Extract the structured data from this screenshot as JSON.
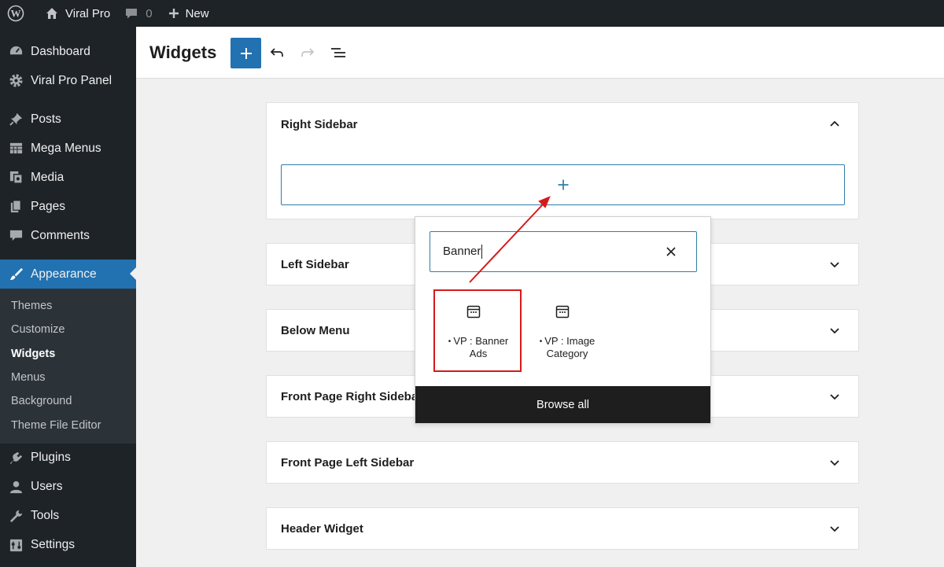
{
  "adminbar": {
    "site_name": "Viral Pro",
    "comments_count": "0",
    "new_label": "New"
  },
  "sidebar": {
    "items": [
      {
        "label": "Dashboard",
        "icon": "dashboard-icon"
      },
      {
        "label": "Viral Pro Panel",
        "icon": "gear-icon"
      },
      {
        "label": "Posts",
        "icon": "pin-icon"
      },
      {
        "label": "Mega Menus",
        "icon": "table-icon"
      },
      {
        "label": "Media",
        "icon": "media-icon"
      },
      {
        "label": "Pages",
        "icon": "pages-icon"
      },
      {
        "label": "Comments",
        "icon": "comment-icon"
      },
      {
        "label": "Appearance",
        "icon": "brush-icon"
      },
      {
        "label": "Plugins",
        "icon": "plugin-icon"
      },
      {
        "label": "Users",
        "icon": "user-icon"
      },
      {
        "label": "Tools",
        "icon": "wrench-icon"
      },
      {
        "label": "Settings",
        "icon": "settings-icon"
      }
    ],
    "submenu": [
      "Themes",
      "Customize",
      "Widgets",
      "Menus",
      "Background",
      "Theme File Editor"
    ],
    "active_submenu": "Widgets"
  },
  "header": {
    "title": "Widgets"
  },
  "widget_areas": [
    {
      "title": "Right Sidebar",
      "expanded": true
    },
    {
      "title": "Left Sidebar",
      "expanded": false
    },
    {
      "title": "Below Menu",
      "expanded": false
    },
    {
      "title": "Front Page Right Sidebar",
      "expanded": false
    },
    {
      "title": "Front Page Left Sidebar",
      "expanded": false
    },
    {
      "title": "Header Widget",
      "expanded": false
    }
  ],
  "inserter": {
    "search_value": "Banner",
    "results": [
      {
        "label": "VP : Banner Ads",
        "icon": "calendar-icon",
        "highlighted": true
      },
      {
        "label": "VP : Image Category",
        "icon": "calendar-icon",
        "highlighted": false
      }
    ],
    "browse_all_label": "Browse all"
  },
  "colors": {
    "admin_dark": "#1d2327",
    "accent": "#2271b1",
    "annotation": "#d61a1a"
  }
}
